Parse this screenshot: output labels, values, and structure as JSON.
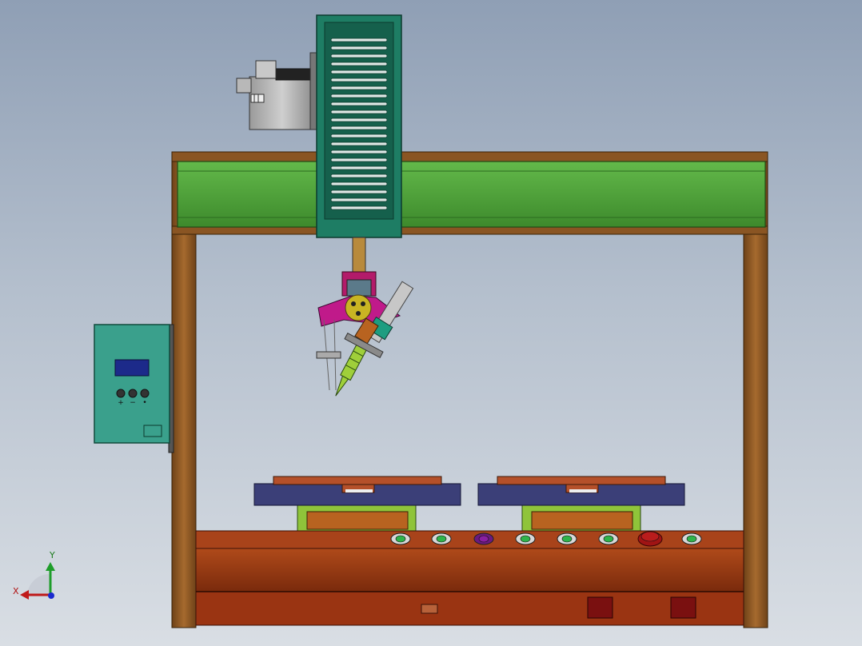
{
  "scene": {
    "description_visible": false,
    "controller_panel": {
      "buttons": [
        {
          "id": "plus",
          "label": "+"
        },
        {
          "id": "minus",
          "label": "−"
        },
        {
          "id": "enter",
          "label": "•"
        }
      ]
    },
    "triad": {
      "x_label": "X",
      "y_label": "Y"
    },
    "colors": {
      "frame_wood": "#8a5523",
      "beam_green": "#4fa33a",
      "carriage_teal": "#1e7d64",
      "panel_teal": "#3aa08c",
      "fixture_blue": "#3b3f78",
      "fixture_top": "#b5502a",
      "base_red": "#9a3412",
      "stop_red": "#b91c1c"
    },
    "front_buttons": [
      {
        "id": "b1",
        "color": "green"
      },
      {
        "id": "b2",
        "color": "green"
      },
      {
        "id": "b3",
        "color": "purple"
      },
      {
        "id": "b4",
        "color": "green"
      },
      {
        "id": "b5",
        "color": "green"
      },
      {
        "id": "b6",
        "color": "green"
      },
      {
        "id": "estop",
        "color": "red"
      },
      {
        "id": "b7",
        "color": "green"
      }
    ]
  }
}
